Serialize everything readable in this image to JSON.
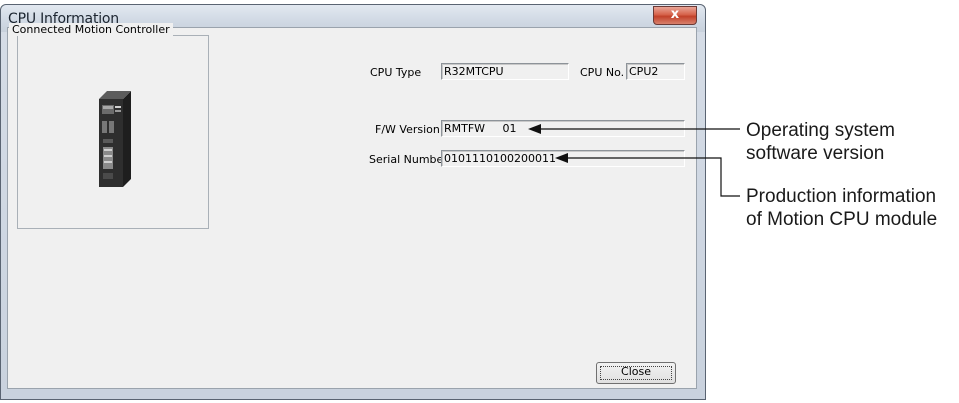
{
  "window": {
    "title": "CPU Information",
    "close_glyph": "x"
  },
  "group": {
    "label": "Connected Motion Controller"
  },
  "cpu_type": {
    "label": "CPU Type",
    "value": "R32MTCPU"
  },
  "cpu_no": {
    "label": "CPU No.",
    "value": "CPU2"
  },
  "fw_version": {
    "label": "F/W Version",
    "value": "RMTFW     01"
  },
  "serial_number": {
    "label": "Serial Number",
    "value": "0101110100200011"
  },
  "buttons": {
    "close_label": "Close"
  },
  "annotations": {
    "os_line1": "Operating system",
    "os_line2": "software version",
    "prod_line1": "Production information",
    "prod_line2": "of Motion CPU module"
  },
  "icons": {
    "controller": "motion-controller-module-icon",
    "arrow": "arrow-left-icon"
  }
}
